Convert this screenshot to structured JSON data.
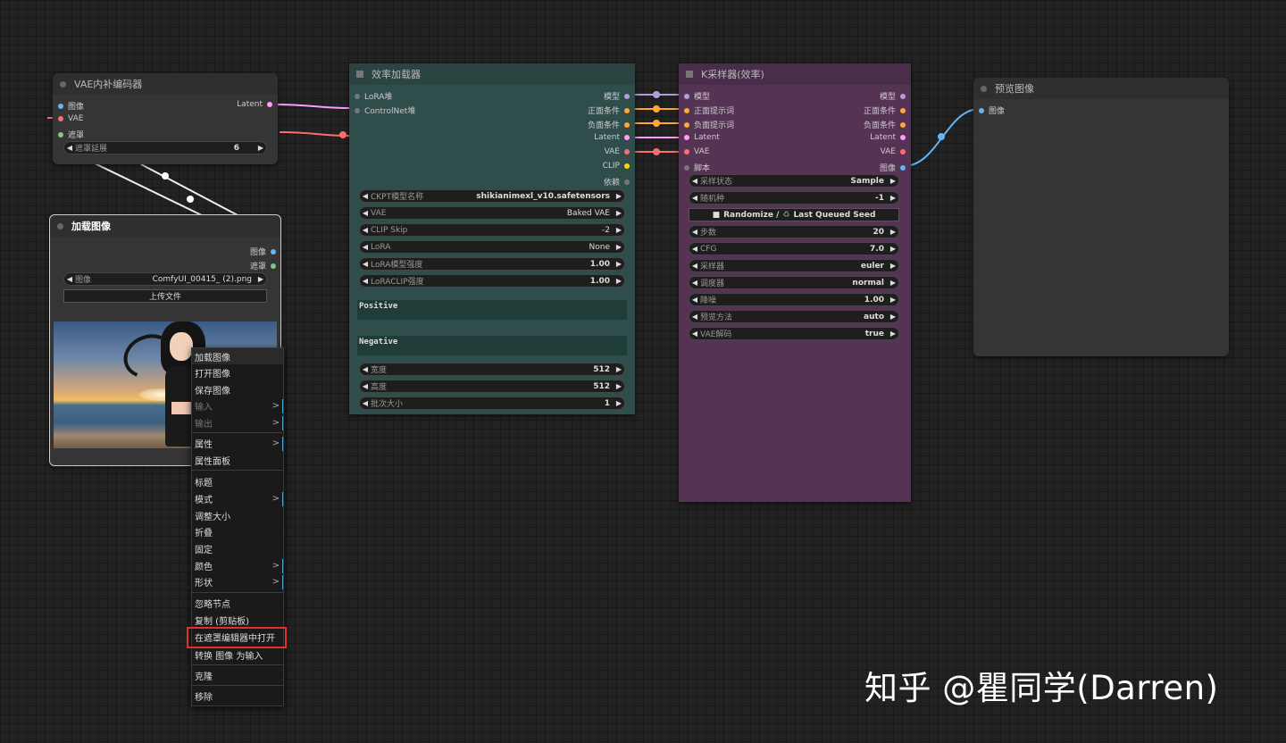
{
  "colors": {
    "accent_blue": "#4aa8d8",
    "latent_pink": "#ff9cf9",
    "vae_red": "#ff6e6e",
    "conditioning_orange": "#ffa931",
    "model_lavender": "#b39ddb",
    "clip_yellow": "#ffd500",
    "mask_green": "#81c784",
    "highlight_red": "#e03030",
    "efficiency_node_bg": "#2e4d4b",
    "ksampler_node_bg": "#553355"
  },
  "vae_encoder": {
    "title": "VAE内补编码器",
    "inputs": [
      "图像",
      "VAE",
      "遮罩"
    ],
    "output_latent": "Latent",
    "widget": {
      "label": "遮罩延展",
      "value": "6"
    }
  },
  "load_image": {
    "title": "加载图像",
    "outputs": [
      "图像",
      "遮罩"
    ],
    "widget": {
      "label": "图像",
      "value": "ComfyUI_00415_ (2).png"
    },
    "upload_button": "上传文件",
    "preview_icon": "anime-girl-beach-image"
  },
  "efficiency_loader": {
    "title": "效率加载器",
    "inputs": [
      "LoRA堆",
      "ControlNet堆"
    ],
    "outputs": [
      "模型",
      "正面条件",
      "负面条件",
      "Latent",
      "VAE",
      "CLIP",
      "依赖"
    ],
    "widgets": [
      {
        "label": "CKPT模型名称",
        "value": "shikianimexl_v10.safetensors"
      },
      {
        "label": "VAE",
        "value": "Baked VAE"
      },
      {
        "label": "CLIP Skip",
        "value": "-2"
      },
      {
        "label": "LoRA",
        "value": "None"
      },
      {
        "label": "LoRA模型强度",
        "value": "1.00"
      },
      {
        "label": "LoRACLIP强度",
        "value": "1.00"
      }
    ],
    "positive_text": "Positive",
    "negative_text": "Negative",
    "size_widgets": [
      {
        "label": "宽度",
        "value": "512"
      },
      {
        "label": "高度",
        "value": "512"
      },
      {
        "label": "批次大小",
        "value": "1"
      }
    ]
  },
  "ksampler": {
    "title": "K采样器(效率)",
    "inputs": [
      "模型",
      "正面提示词",
      "负面提示词",
      "Latent",
      "VAE",
      "脚本"
    ],
    "outputs": [
      "模型",
      "正面条件",
      "负面条件",
      "Latent",
      "VAE",
      "图像"
    ],
    "widgets_top": [
      {
        "label": "采样状态",
        "value": "Sample"
      },
      {
        "label": "随机种",
        "value": "-1"
      }
    ],
    "seed_button": {
      "left": "Randomize /",
      "right": "Last Queued Seed"
    },
    "widgets": [
      {
        "label": "步数",
        "value": "20"
      },
      {
        "label": "CFG",
        "value": "7.0"
      },
      {
        "label": "采样器",
        "value": "euler"
      },
      {
        "label": "调度器",
        "value": "normal"
      },
      {
        "label": "降噪",
        "value": "1.00"
      },
      {
        "label": "预览方法",
        "value": "auto"
      },
      {
        "label": "VAE解码",
        "value": "true"
      }
    ]
  },
  "preview_image": {
    "title": "预览图像",
    "input": "图像"
  },
  "context_menu": {
    "items": [
      {
        "label": "加载图像",
        "disabled": false,
        "submenu": false
      },
      {
        "label": "打开图像",
        "disabled": false,
        "submenu": false
      },
      {
        "label": "保存图像",
        "disabled": false,
        "submenu": false
      },
      {
        "label": "输入",
        "disabled": true,
        "submenu": true
      },
      {
        "label": "输出",
        "disabled": true,
        "submenu": true
      },
      {
        "label": "属性",
        "disabled": false,
        "submenu": true
      },
      {
        "label": "属性面板",
        "disabled": false,
        "submenu": false
      },
      {
        "label": "标题",
        "disabled": false,
        "submenu": false
      },
      {
        "label": "模式",
        "disabled": false,
        "submenu": true
      },
      {
        "label": "调整大小",
        "disabled": false,
        "submenu": false
      },
      {
        "label": "折叠",
        "disabled": false,
        "submenu": false
      },
      {
        "label": "固定",
        "disabled": false,
        "submenu": false
      },
      {
        "label": "颜色",
        "disabled": false,
        "submenu": true
      },
      {
        "label": "形状",
        "disabled": false,
        "submenu": true
      },
      {
        "label": "忽略节点",
        "disabled": false,
        "submenu": false
      },
      {
        "label": "复制 (剪贴板)",
        "disabled": false,
        "submenu": false
      },
      {
        "label": "在遮罩编辑器中打开",
        "disabled": false,
        "submenu": false
      },
      {
        "label": "转换 图像 为输入",
        "disabled": false,
        "submenu": false
      },
      {
        "label": "克隆",
        "disabled": false,
        "submenu": false
      },
      {
        "label": "移除",
        "disabled": false,
        "submenu": false
      }
    ],
    "submenu_glyph": ">"
  },
  "watermark": "知乎 @瞿同学(Darren)"
}
